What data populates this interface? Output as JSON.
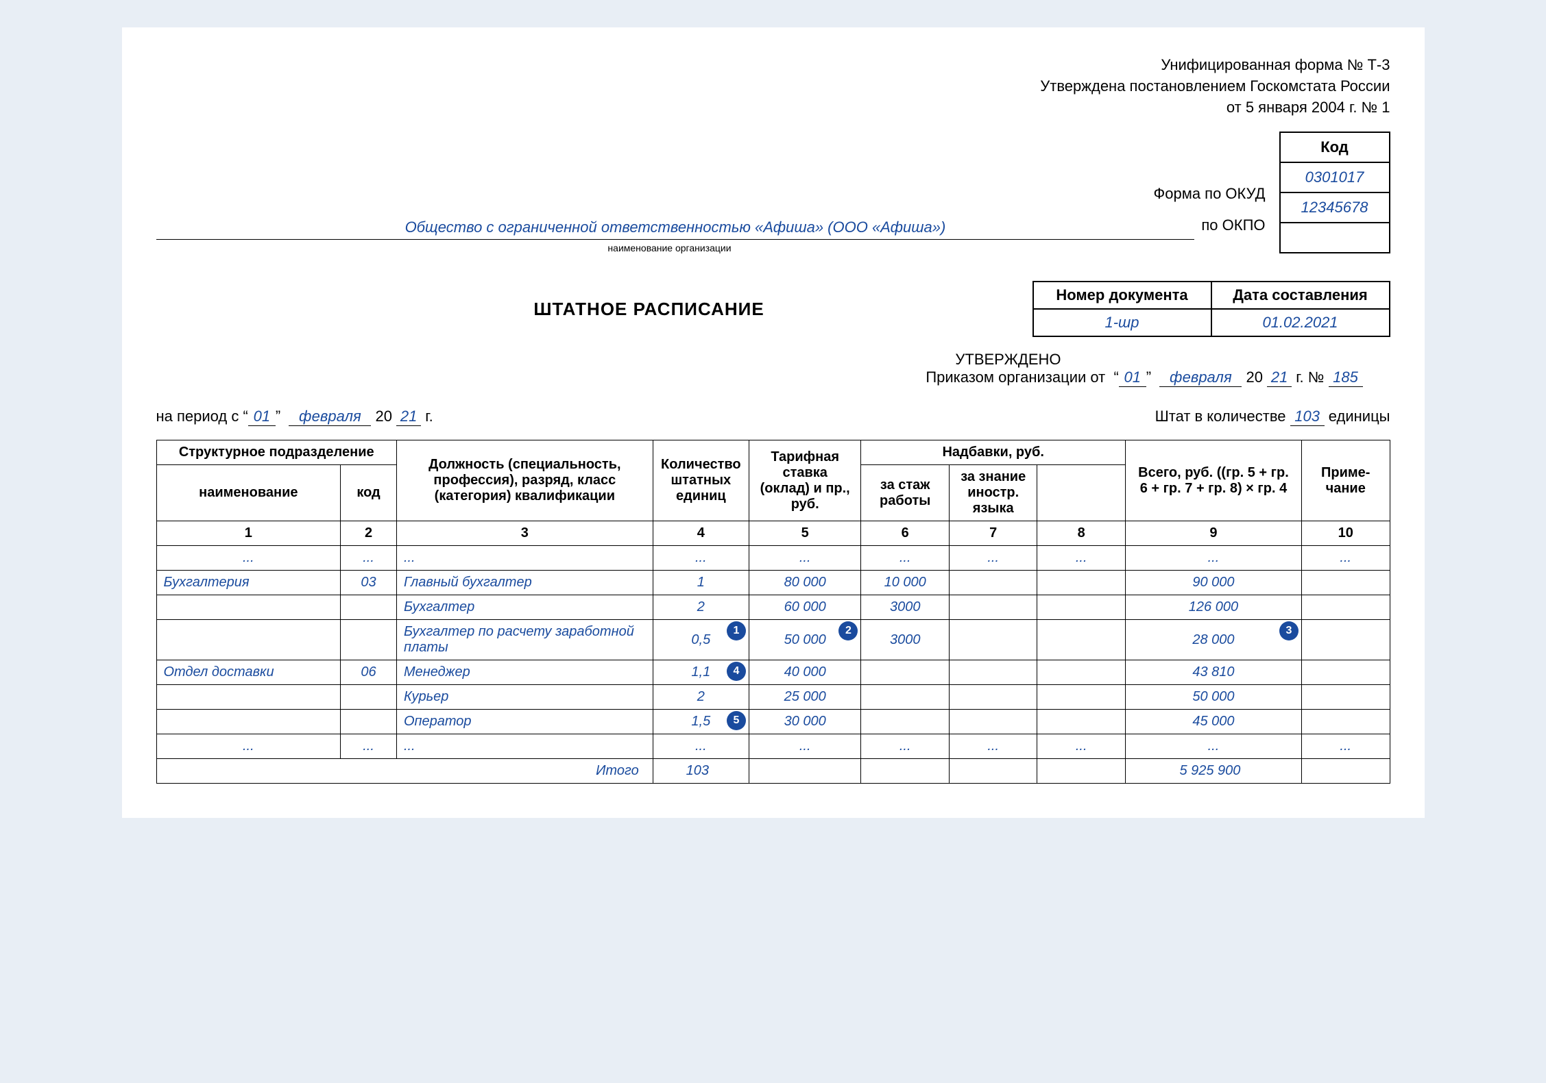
{
  "header": {
    "line1": "Унифицированная форма № Т-3",
    "line2": "Утверждена постановлением Госкомстата России",
    "line3": "от 5 января 2004 г. № 1"
  },
  "codes": {
    "kod_header": "Код",
    "okud_label": "Форма по ОКУД",
    "okud_value": "0301017",
    "okpo_label": "по ОКПО",
    "okpo_value": "12345678"
  },
  "org": {
    "name": "Общество с ограниченной ответственностью «Афиша» (ООО «Афиша»)",
    "sub": "наименование организации"
  },
  "doc": {
    "title": "ШТАТНОЕ РАСПИСАНИЕ",
    "num_header": "Номер документа",
    "date_header": "Дата составления",
    "num_value": "1-шр",
    "date_value": "01.02.2021"
  },
  "approval": {
    "approved": "УТВЕРЖДЕНО",
    "prefix": "Приказом организации от",
    "day": "01",
    "month": "февраля",
    "year_prefix": "20",
    "year": "21",
    "year_suffix": "г. №",
    "order_num": "185"
  },
  "period": {
    "prefix": "на период  с",
    "day": "01",
    "month": "февраля",
    "year_prefix": "20",
    "year": "21",
    "year_suffix": "г."
  },
  "staff_count": {
    "prefix": "Штат в количестве",
    "value": "103",
    "suffix": "единицы"
  },
  "columns": {
    "struct": "Структурное подразделение",
    "name": "наименование",
    "code": "код",
    "position": "Должность (специальность, профессия), разряд, класс (категория) квалификации",
    "qty": "Количе­ство штат­ных единиц",
    "rate": "Тарифная ставка (оклад) и пр., руб.",
    "allowances": "Надбавки, руб.",
    "seniority": "за стаж работы",
    "language": "за знание иностр. языка",
    "blank": "",
    "total": "Всего, руб. ((гр. 5 + гр. 6 + гр. 7 +  гр. 8) × гр. 4",
    "note": "Приме­чание"
  },
  "colnums": [
    "1",
    "2",
    "3",
    "4",
    "5",
    "6",
    "7",
    "8",
    "9",
    "10"
  ],
  "ellipsis": "...",
  "rows": [
    {
      "dept": "Бухгалтерия",
      "code": "03",
      "pos": "Главный бухгалтер",
      "qty": "1",
      "rate": "80 000",
      "a1": "10 000",
      "a2": "",
      "a3": "",
      "total": "90 000",
      "note": "",
      "badges": {}
    },
    {
      "dept": "",
      "code": "",
      "pos": "Бухгалтер",
      "qty": "2",
      "rate": "60 000",
      "a1": "3000",
      "a2": "",
      "a3": "",
      "total": "126 000",
      "note": "",
      "badges": {}
    },
    {
      "dept": "",
      "code": "",
      "pos": "Бухгалтер по расчету заработной платы",
      "qty": "0,5",
      "rate": "50 000",
      "a1": "3000",
      "a2": "",
      "a3": "",
      "total": "28 000",
      "note": "",
      "badges": {
        "qty": "1",
        "rate": "2",
        "total": "3"
      }
    },
    {
      "dept": "Отдел доставки",
      "code": "06",
      "pos": "Менеджер",
      "qty": "1,1",
      "rate": "40 000",
      "a1": "",
      "a2": "",
      "a3": "",
      "total": "43 810",
      "note": "",
      "badges": {
        "qty": "4"
      }
    },
    {
      "dept": "",
      "code": "",
      "pos": "Курьер",
      "qty": "2",
      "rate": "25 000",
      "a1": "",
      "a2": "",
      "a3": "",
      "total": "50 000",
      "note": "",
      "badges": {}
    },
    {
      "dept": "",
      "code": "",
      "pos": "Оператор",
      "qty": "1,5",
      "rate": "30 000",
      "a1": "",
      "a2": "",
      "a3": "",
      "total": "45 000",
      "note": "",
      "badges": {
        "qty": "5"
      }
    }
  ],
  "totals": {
    "label": "Итого",
    "qty": "103",
    "total": "5 925 900"
  }
}
